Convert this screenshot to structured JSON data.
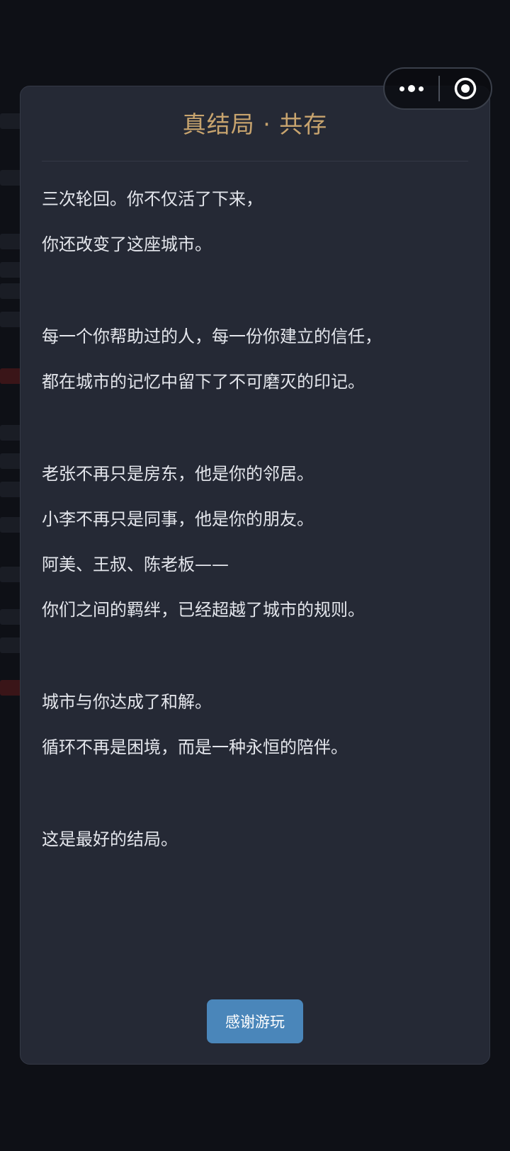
{
  "capsule": {
    "more_icon": "more-dots-icon",
    "close_icon": "target-close-icon"
  },
  "modal": {
    "title": "真结局 · 共存",
    "story_lines": [
      "三次轮回。你不仅活了下来，",
      "你还改变了这座城市。",
      "",
      "每一个你帮助过的人，每一份你建立的信任，",
      "都在城市的记忆中留下了不可磨灭的印记。",
      "",
      "老张不再只是房东，他是你的邻居。",
      "小李不再只是同事，他是你的朋友。",
      "阿美、王叔、陈老板——",
      "你们之间的羁绊，已经超越了城市的规则。",
      "",
      "城市与你达成了和解。",
      "循环不再是困境，而是一种永恒的陪伴。",
      "",
      "这是最好的结局。"
    ],
    "button_label": "感谢游玩"
  },
  "colors": {
    "background": "#0f1117",
    "card": "#252935",
    "title_gold": "#c8a46e",
    "text": "#e4e6ec",
    "button": "#4a86ba"
  }
}
